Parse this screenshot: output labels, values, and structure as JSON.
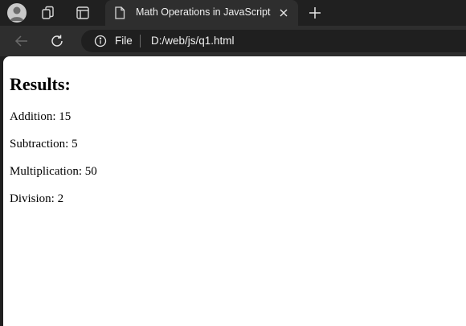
{
  "tab": {
    "title": "Math Operations in JavaScript"
  },
  "address_bar": {
    "scheme_label": "File",
    "url": "D:/web/js/q1.html"
  },
  "page": {
    "heading": "Results:",
    "results": [
      "Addition: 15",
      "Subtraction: 5",
      "Multiplication: 50",
      "Division: 2"
    ]
  },
  "icons": {
    "avatar": "profile-avatar-icon",
    "workspaces": "workspaces-icon",
    "tab_actions": "tab-actions-icon",
    "tab_page": "page-icon",
    "tab_close": "close-icon",
    "new_tab": "plus-icon",
    "back": "back-arrow-icon",
    "refresh": "refresh-icon",
    "site_info": "info-icon"
  },
  "colors": {
    "chrome_bg": "#202020",
    "active_tab_bg": "#2e2e2e",
    "address_bg": "#1f1f1f",
    "page_bg": "#ffffff",
    "text_light": "#f0f0f0"
  }
}
